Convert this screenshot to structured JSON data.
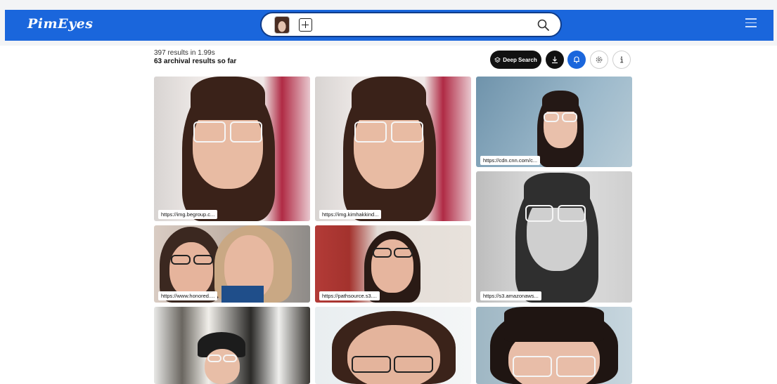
{
  "header": {
    "logo": "PimEyes",
    "icons": [
      "face-thumbnail",
      "add-icon",
      "search-icon",
      "menu-icon"
    ]
  },
  "results": {
    "count_text": "397 results in 1.99s",
    "archival_text": "63 archival results so far"
  },
  "toolbar": {
    "deep_search_label": "Deep Search",
    "icons": [
      "layers-icon",
      "download-icon",
      "bell-icon",
      "gear-icon",
      "info-icon"
    ]
  },
  "cards": [
    {
      "url": "https://img.begroup.c..."
    },
    {
      "url": "https://img.kimhakkind..."
    },
    {
      "url": "https://cdn.cnn.com/c..."
    },
    {
      "url": "https://www.honored...."
    },
    {
      "url": "https://pathsource.s3...."
    },
    {
      "url": "https://s3.amazonaws..."
    }
  ],
  "colors": {
    "brand_blue": "#1a66dc",
    "dark_button": "#111111"
  }
}
